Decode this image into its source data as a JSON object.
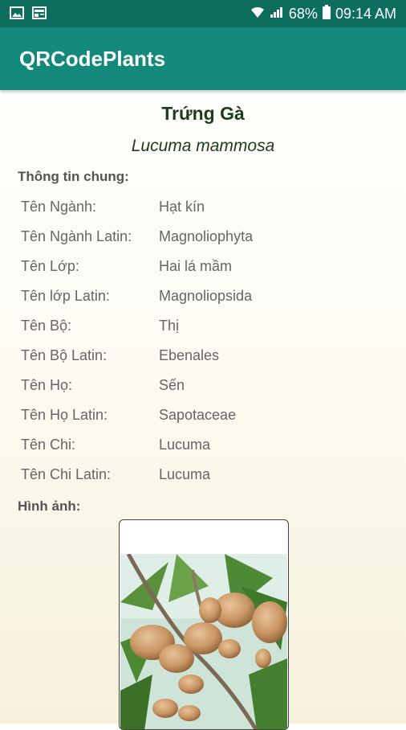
{
  "statusbar": {
    "battery": "68%",
    "time": "09:14 AM"
  },
  "app": {
    "title": "QRCodePlants"
  },
  "plant": {
    "name": "Trứng Gà",
    "latin_name": "Lucuma mammosa"
  },
  "general_info": {
    "title": "Thông tin chung:",
    "rows": [
      {
        "label": "Tên Ngành:",
        "value": "Hạt kín"
      },
      {
        "label": "Tên Ngành Latin:",
        "value": "Magnoliophyta"
      },
      {
        "label": "Tên Lớp:",
        "value": "Hai lá mầm"
      },
      {
        "label": "Tên lớp Latin:",
        "value": "Magnoliopsida"
      },
      {
        "label": "Tên Bộ:",
        "value": "Thị"
      },
      {
        "label": "Tên Bộ Latin:",
        "value": "Ebenales"
      },
      {
        "label": "Tên Họ:",
        "value": "Sến"
      },
      {
        "label": "Tên Họ Latin:",
        "value": "Sapotaceae"
      },
      {
        "label": "Tên Chi:",
        "value": "Lucuma"
      },
      {
        "label": "Tên Chi Latin:",
        "value": "Lucuma"
      }
    ]
  },
  "images": {
    "title": "Hình ảnh:"
  },
  "colors": {
    "status_bar": "#0e6e5e",
    "app_bar": "#12897a",
    "title_text": "#1d3b1d"
  }
}
